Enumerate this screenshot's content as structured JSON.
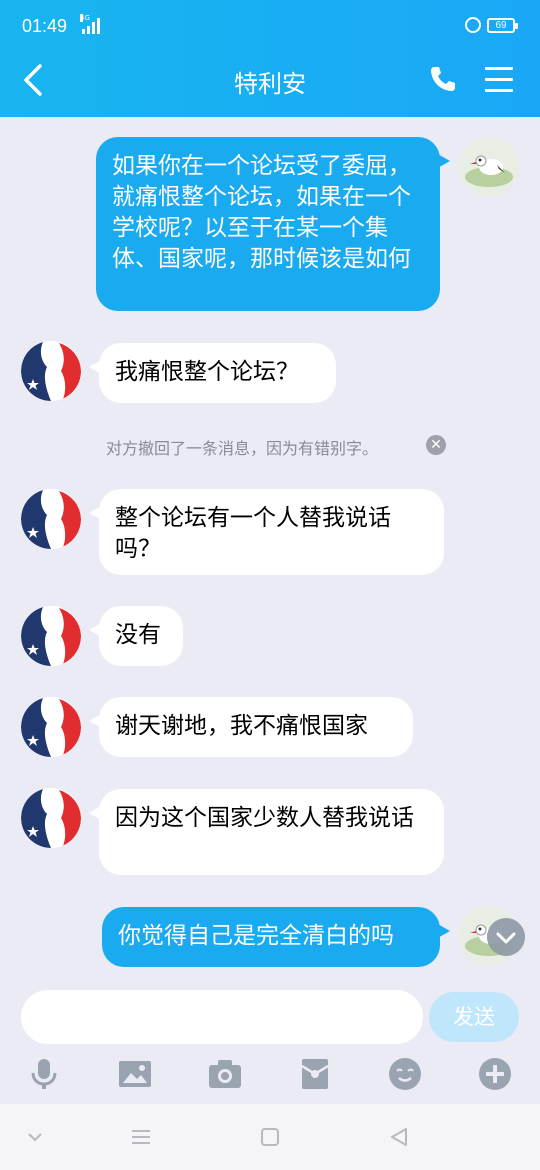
{
  "status": {
    "time": "01:49",
    "network": "4G",
    "battery": "69"
  },
  "header": {
    "title": "特利安"
  },
  "messages": [
    {
      "side": "mine",
      "text": "如果你在一个论坛受了委屈，就痛恨整个论坛，如果在一个学校呢？以至于在某一个集体、国家呢，那时候该是如何"
    },
    {
      "side": "theirs",
      "text": "我痛恨整个论坛？"
    },
    {
      "side": "theirs",
      "text": "整个论坛有一个人替我说话吗？"
    },
    {
      "side": "theirs",
      "text": "没有"
    },
    {
      "side": "theirs",
      "text": "谢天谢地，我不痛恨国家"
    },
    {
      "side": "theirs",
      "text": "因为这个国家少数人替我说话"
    },
    {
      "side": "mine",
      "text": "你觉得自己是完全清白的吗"
    }
  ],
  "recall_notice": "对方撤回了一条消息，因为有错别字。",
  "input": {
    "placeholder": "",
    "value": "",
    "send_label": "发送"
  },
  "toolbar": {
    "icons": [
      "microphone-icon",
      "image-icon",
      "camera-icon",
      "red-packet-icon",
      "emoji-icon",
      "plus-icon"
    ]
  },
  "colors": {
    "accent": "#1aaaf0",
    "bubble_mine": "#1aaaf0",
    "bubble_theirs": "#ffffff",
    "background": "#ebebf5"
  }
}
